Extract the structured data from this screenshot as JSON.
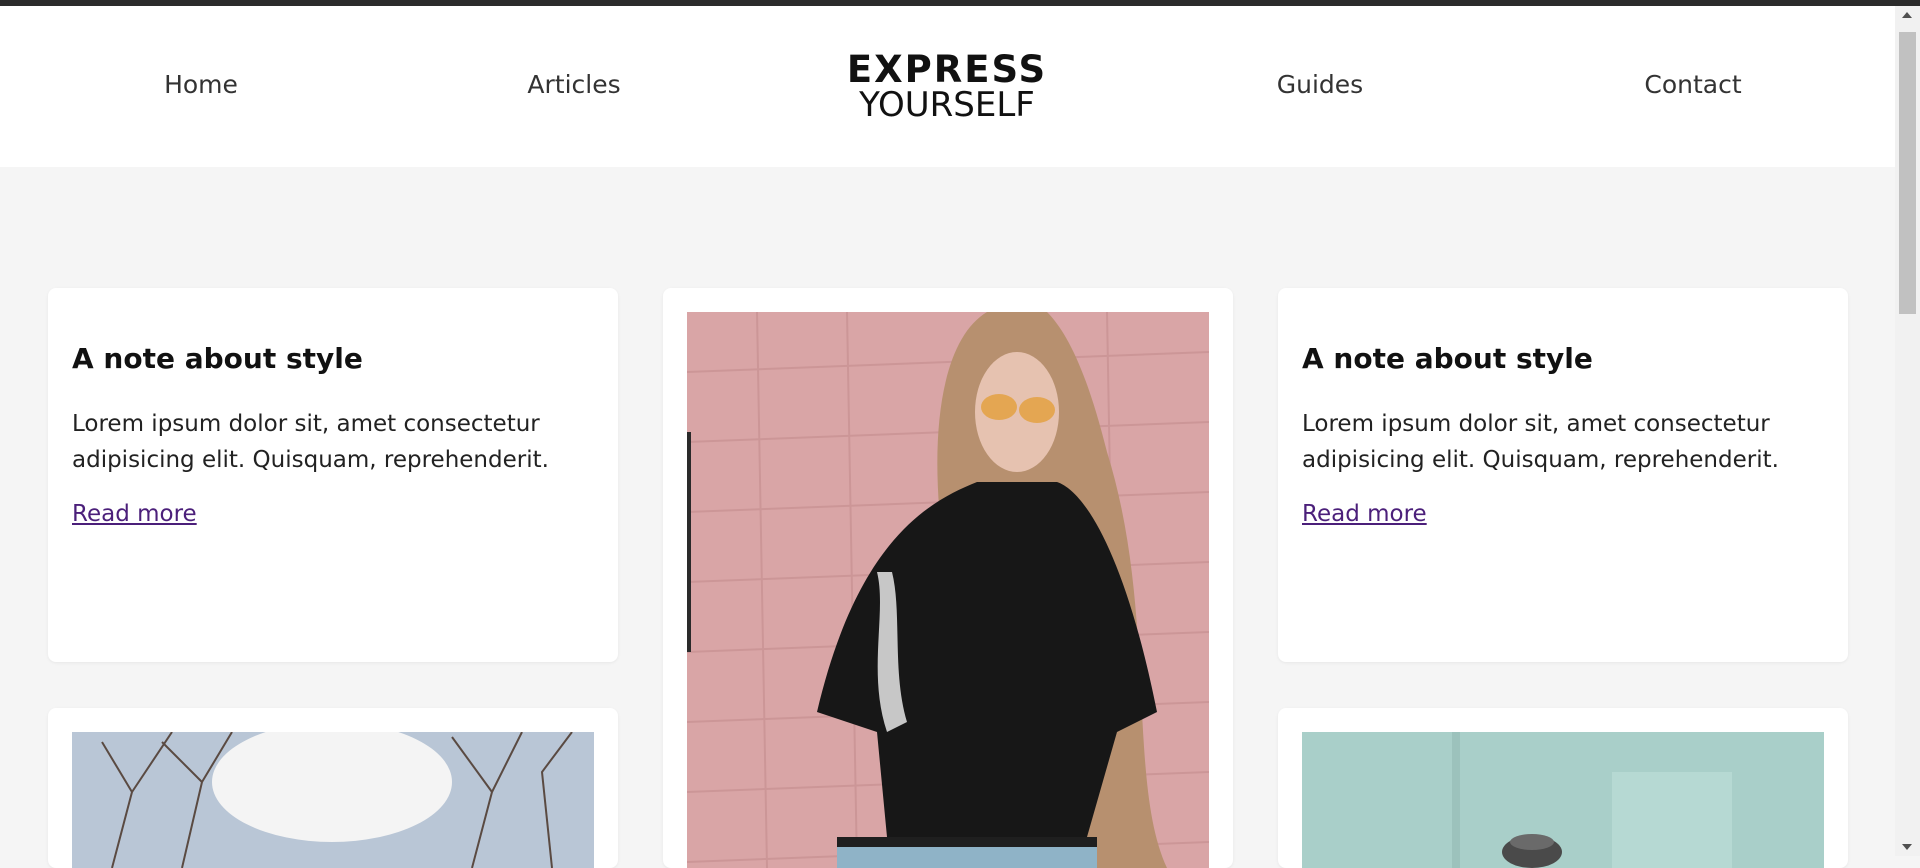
{
  "nav": {
    "home": "Home",
    "articles": "Articles",
    "guides": "Guides",
    "contact": "Contact"
  },
  "logo": {
    "line1": "EXPRESS",
    "line2": "YOURSELF"
  },
  "cards": [
    {
      "title": "A note about style",
      "text": "Lorem ipsum dolor sit, amet consectetur adipisicing elit. Quisquam, reprehenderit.",
      "link": "Read more"
    },
    {
      "title": "A note about style",
      "text": "Lorem ipsum dolor sit, amet consectetur adipisicing elit. Quisquam, reprehenderit.",
      "link": "Read more"
    }
  ],
  "colors": {
    "page_background": "#f5f5f5",
    "card_background": "#ffffff",
    "link_visited": "#4b1f7a",
    "top_border": "#2b2b2b"
  }
}
